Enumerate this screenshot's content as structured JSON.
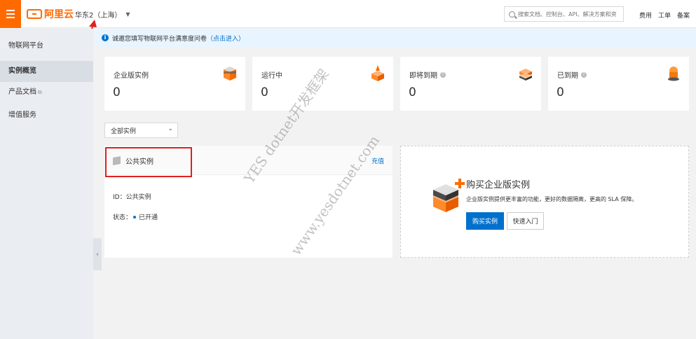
{
  "header": {
    "brand": "阿里云",
    "region": "华东2（上海）",
    "search_placeholder": "搜索文档、控制台、API、解决方案和资",
    "links": [
      "费用",
      "工单",
      "备案"
    ]
  },
  "sidebar": {
    "title": "物联网平台",
    "items": [
      {
        "label": "实例概览",
        "active": true
      },
      {
        "label": "产品文档",
        "external": true
      },
      {
        "label": "增值服务"
      }
    ]
  },
  "notice": {
    "text": "诚邀您填写物联网平台满意度问卷",
    "link": "（点击进入）"
  },
  "stats": [
    {
      "label": "企业版实例",
      "value": "0",
      "icon": "enterprise-instance-icon",
      "help": false
    },
    {
      "label": "运行中",
      "value": "0",
      "icon": "running-icon",
      "help": false
    },
    {
      "label": "即将到期",
      "value": "0",
      "icon": "expiring-icon",
      "help": true
    },
    {
      "label": "已到期",
      "value": "0",
      "icon": "expired-icon",
      "help": true
    }
  ],
  "filter": {
    "selected": "全部实例"
  },
  "public_instance": {
    "title": "公共实例",
    "action": "充值",
    "id_line": "ID：公共实例",
    "status_label": "状态：",
    "status_value": "已开通"
  },
  "promo": {
    "title": "购买企业版实例",
    "description": "企业版实例提供更丰富的功能，更好的数据隔离，更高的 SLA 保障。",
    "buy_label": "购买实例",
    "guide_label": "快速入门"
  },
  "watermark": {
    "line1": "YES dotnet开发框架",
    "line2": "www.yesdotnet.com"
  },
  "colors": {
    "brand": "#ff6a00",
    "primary": "#0070cc",
    "annotation": "#e02020"
  }
}
